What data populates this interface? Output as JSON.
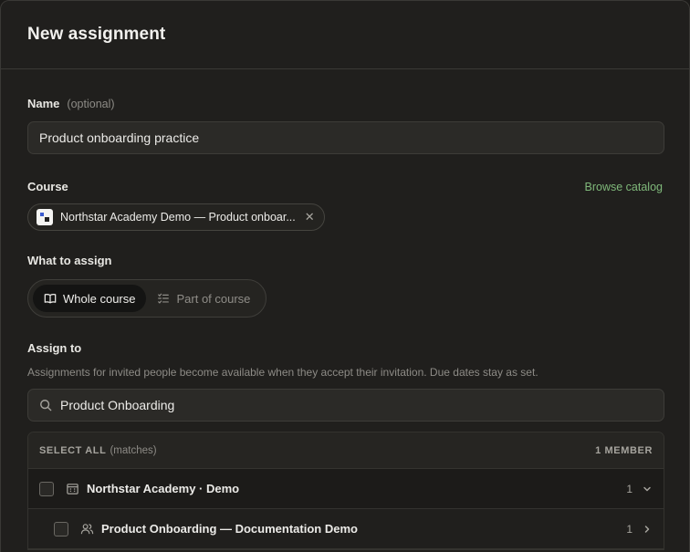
{
  "dialog": {
    "title": "New assignment"
  },
  "name_field": {
    "label": "Name",
    "optional": "(optional)",
    "value": "Product onboarding practice"
  },
  "course": {
    "label": "Course",
    "browse_link": "Browse catalog",
    "chip_text": "Northstar Academy Demo — Product onboar...",
    "remove_glyph": "✕"
  },
  "what_to_assign": {
    "label": "What to assign",
    "options": [
      {
        "label": "Whole course",
        "icon": "book-open-icon",
        "selected": true
      },
      {
        "label": "Part of course",
        "icon": "checklist-icon",
        "selected": false
      }
    ]
  },
  "assign_to": {
    "label": "Assign to",
    "hint": "Assignments for invited people become available when they accept their invitation. Due dates stay as set.",
    "search_value": "Product Onboarding",
    "list": {
      "select_all": "SELECT ALL",
      "matches": "(matches)",
      "member_count": "1 MEMBER",
      "rows": [
        {
          "label": "Northstar Academy · Demo",
          "count": "1",
          "icon": "building-icon",
          "chevron": "chevron-down-icon"
        },
        {
          "label": "Product Onboarding — Documentation Demo",
          "count": "1",
          "icon": "users-icon",
          "chevron": "chevron-right-icon"
        }
      ]
    }
  },
  "colors": {
    "background": "#201f1d",
    "accent_link": "#7fb87a",
    "input_bg": "#2b2a27",
    "border": "#3a3936"
  }
}
